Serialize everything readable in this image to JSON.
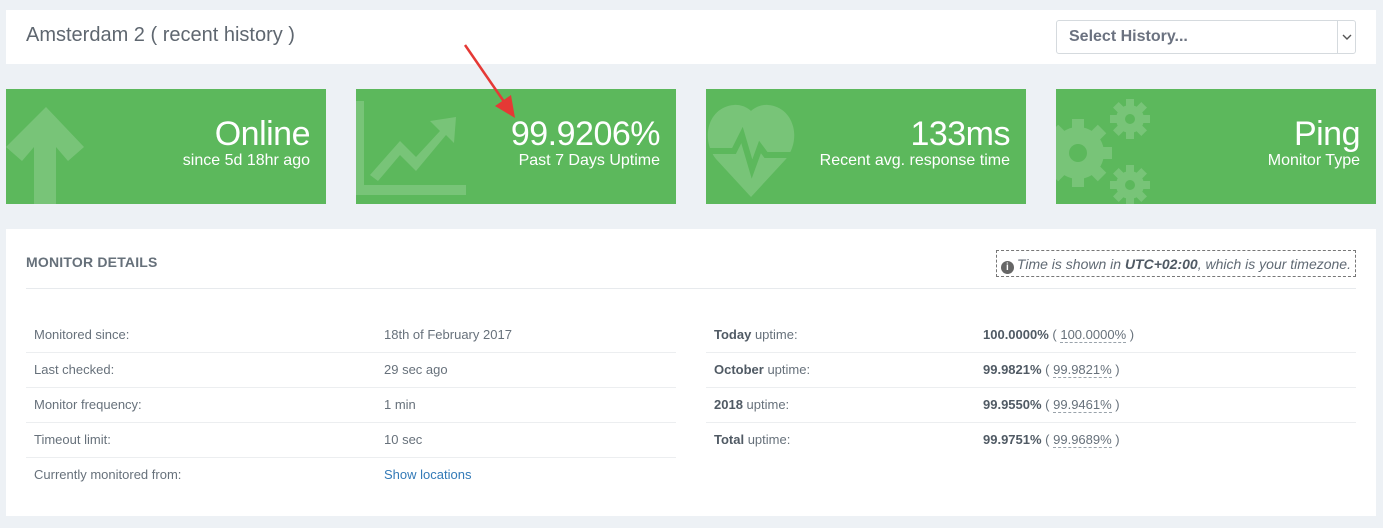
{
  "header": {
    "title": "Amsterdam 2 ( recent history )",
    "history_select": {
      "value": "Select History..."
    }
  },
  "tiles": [
    {
      "value": "Online",
      "caption": "since 5d 18hr ago",
      "icon": "arrow-up-icon"
    },
    {
      "value": "99.9206%",
      "caption": "Past 7 Days Uptime",
      "icon": "trend-up-icon"
    },
    {
      "value": "133ms",
      "caption": "Recent avg. response time",
      "icon": "heartbeat-icon"
    },
    {
      "value": "Ping",
      "caption": "Monitor Type",
      "icon": "gears-icon"
    }
  ],
  "colors": {
    "tile_green": "#5cb85c",
    "annotation_arrow": "#e53935",
    "link": "#337ab7"
  },
  "details": {
    "title": "MONITOR DETAILS",
    "tz": {
      "prefix": "Time is shown in ",
      "zone": "UTC+02:00",
      "suffix": ", which is your timezone."
    },
    "left": [
      {
        "label": "Monitored since:",
        "value": "18th of February 2017"
      },
      {
        "label": "Last checked:",
        "value": "29 sec ago"
      },
      {
        "label": "Monitor frequency:",
        "value": "1 min"
      },
      {
        "label": "Timeout limit:",
        "value": "10 sec"
      },
      {
        "label": "Currently monitored from:",
        "value": "Show locations"
      }
    ],
    "right": [
      {
        "period": "Today",
        "suffix": " uptime:",
        "value": "100.0000%",
        "alt": "100.0000%"
      },
      {
        "period": "October",
        "suffix": " uptime:",
        "value": "99.9821%",
        "alt": "99.9821%"
      },
      {
        "period": "2018",
        "suffix": " uptime:",
        "value": "99.9550%",
        "alt": "99.9461%"
      },
      {
        "period": "Total",
        "suffix": " uptime:",
        "value": "99.9751%",
        "alt": "99.9689%"
      }
    ]
  }
}
